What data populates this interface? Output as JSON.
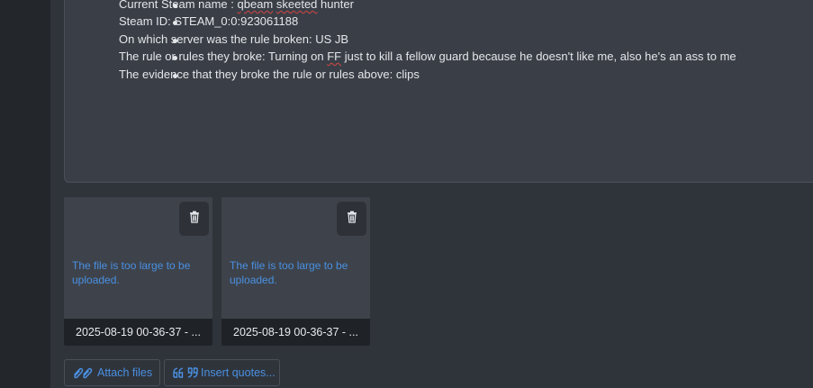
{
  "editor": {
    "lines": [
      {
        "parts": [
          {
            "t": "Current Steam name : ",
            "sq": false
          },
          {
            "t": "qbeam",
            "sq": true
          },
          {
            "t": " ",
            "sq": false
          },
          {
            "t": "skeeted",
            "sq": true
          },
          {
            "t": " hunter",
            "sq": false
          }
        ]
      },
      {
        "parts": [
          {
            "t": "Steam ID: STEAM_0:0:923061188",
            "sq": false
          }
        ]
      },
      {
        "parts": [
          {
            "t": "On which server was the rule broken: US JB",
            "sq": false
          }
        ]
      },
      {
        "parts": [
          {
            "t": "The rule or rules they broke: Turning on ",
            "sq": false
          },
          {
            "t": "FF",
            "sq": true
          },
          {
            "t": " just to kill a fellow guard because he doesn't like me, also he's an ass to me",
            "sq": false
          }
        ]
      },
      {
        "parts": [
          {
            "t": "The evidence that they broke the rule or rules above: clips",
            "sq": false
          }
        ]
      }
    ]
  },
  "attachments": [
    {
      "error": "The file is too large to be uploaded.",
      "filename": "2025-08-19 00-36-37 - ...",
      "icon": "trash-icon"
    },
    {
      "error": "The file is too large to be uploaded.",
      "filename": "2025-08-19 00-36-37 - ...",
      "icon": "trash-icon"
    }
  ],
  "buttons": {
    "attach_label": "Attach files",
    "attach_icon": "paperclip-icon",
    "quotes_label": "Insert quotes...",
    "quotes_icon": "quote-icon"
  },
  "colors": {
    "link": "#4a90e2",
    "spellcheck": "#d64545"
  }
}
